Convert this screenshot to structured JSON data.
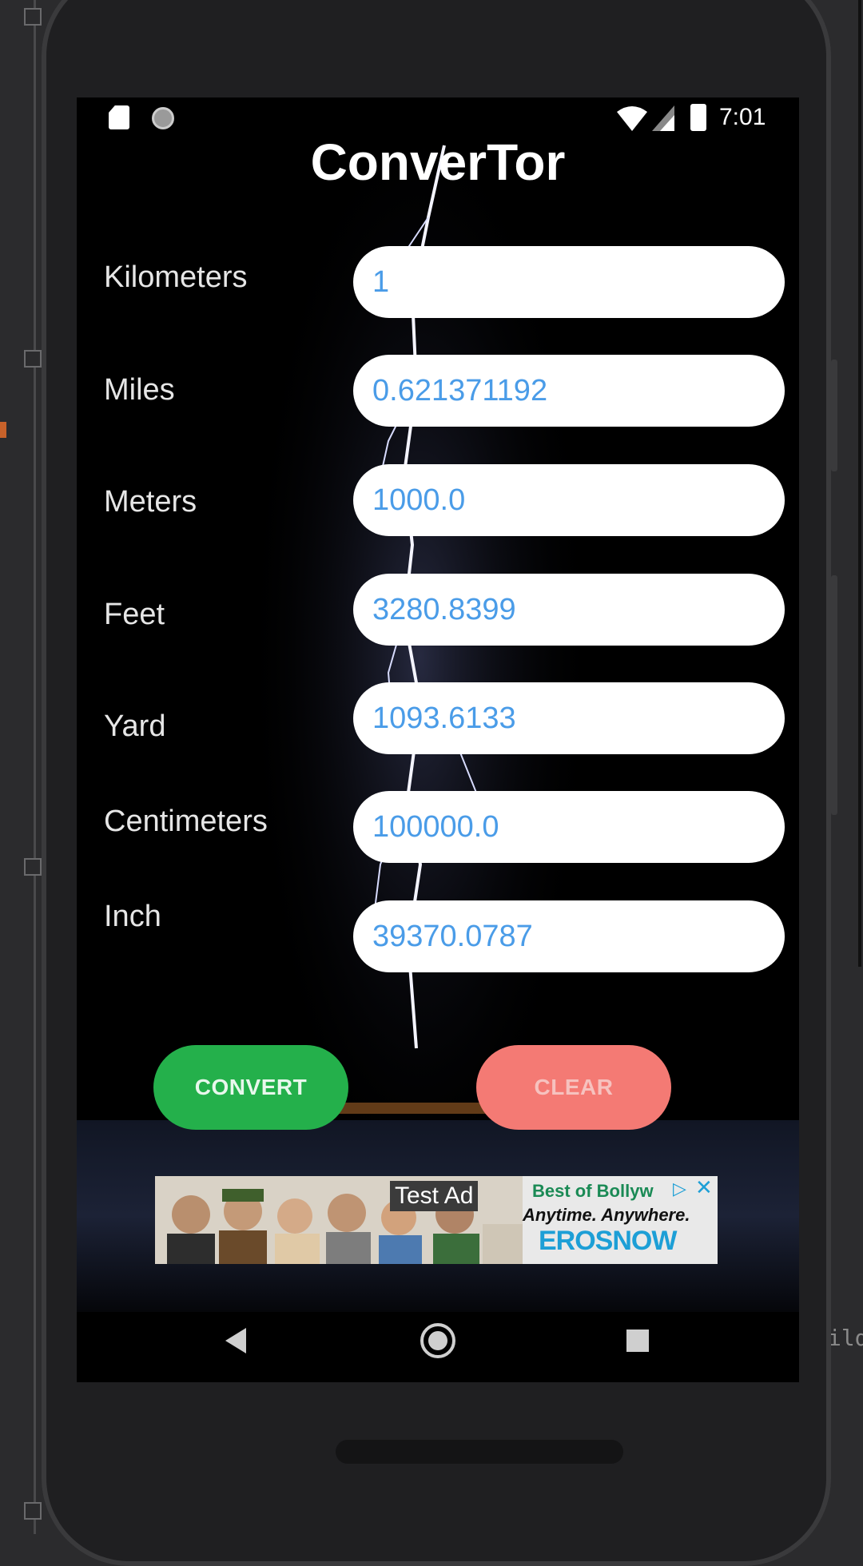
{
  "app": {
    "title": "ConverTor"
  },
  "status_bar": {
    "time": "7:01"
  },
  "rows": [
    {
      "label": "Kilometers",
      "value": "1"
    },
    {
      "label": "Miles",
      "value": "0.621371192"
    },
    {
      "label": "Meters",
      "value": "1000.0"
    },
    {
      "label": "Feet",
      "value": "3280.8399"
    },
    {
      "label": "Yard",
      "value": "1093.6133"
    },
    {
      "label": "Centimeters",
      "value": "100000.0"
    },
    {
      "label": "Inch",
      "value": "39370.0787"
    }
  ],
  "buttons": {
    "convert": "CONVERT",
    "clear": "CLEAR"
  },
  "ad": {
    "badge": "Test Ad",
    "line1": "Best of Bollyw",
    "line2": "Anytime. Anywhere.",
    "brand": "EROSNOW"
  },
  "ide": {
    "right_text": "ild"
  },
  "colors": {
    "accent_value": "#4a9ce8",
    "convert_button": "#24b04b",
    "clear_button": "#f47a74"
  },
  "icons": [
    "sd-card-icon",
    "circle-status-icon",
    "wifi-icon",
    "signal-icon",
    "battery-icon",
    "back-icon",
    "home-icon",
    "recents-icon",
    "ad-info-icon",
    "ad-close-icon"
  ]
}
